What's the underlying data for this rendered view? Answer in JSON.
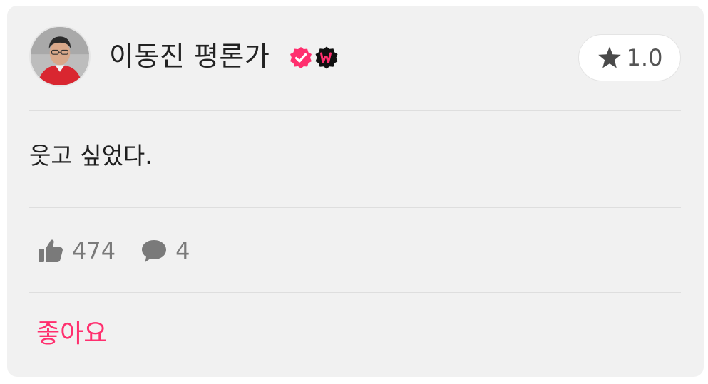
{
  "review": {
    "reviewer_name": "이동진 평론가",
    "rating_value": "1.0",
    "comment": "웃고 싶었다.",
    "likes_count": "474",
    "comments_count": "4",
    "like_button_label": "좋아요"
  },
  "icons": {
    "verified": "verified-badge-icon",
    "watcha": "watcha-w-badge-icon",
    "star": "star-icon",
    "thumbs_up": "thumbs-up-icon",
    "comment": "comment-bubble-icon"
  },
  "colors": {
    "accent": "#ff2f6e",
    "card_background": "#f1f1f1",
    "muted_text": "#7a7a7a",
    "star": "#555555"
  }
}
